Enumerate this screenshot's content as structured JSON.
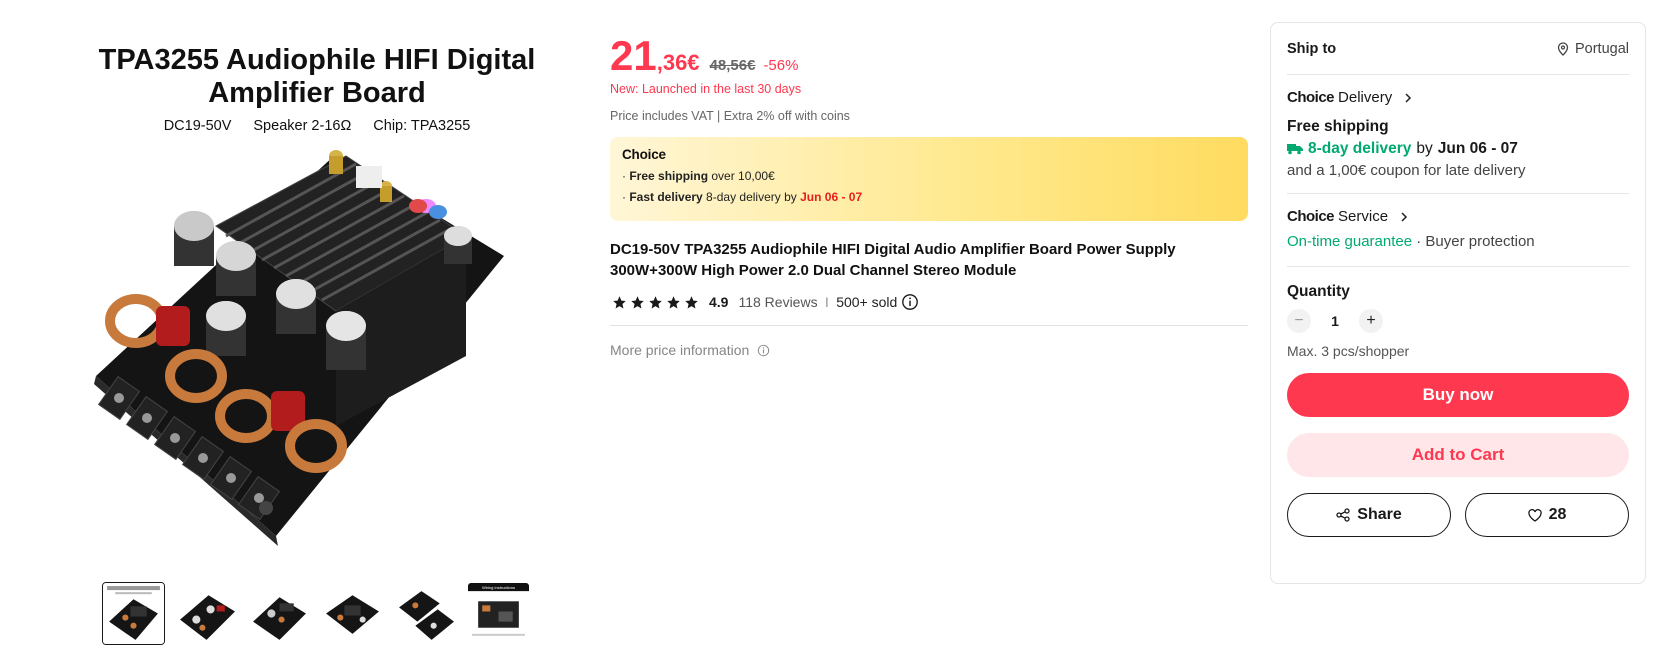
{
  "gallery": {
    "hero_title": "TPA3255 Audiophile HIFI Digital Amplifier Board",
    "hero_specs": [
      "DC19-50V",
      "Speaker 2-16Ω",
      "Chip: TPA3255"
    ],
    "thumbnail_count": 6,
    "active_thumbnail": 1,
    "thumb6_label": "Wiring instructions"
  },
  "price": {
    "integer": "21",
    "decimal": ",36€",
    "original": "48,56€",
    "discount": "-56%",
    "new_tag": "New: Launched in the last 30 days",
    "vat_note": "Price includes VAT | Extra 2% off with coins"
  },
  "choice_box": {
    "brand": "Choice",
    "free_shipping_label": "Free shipping",
    "free_shipping_text": " over 10,00€",
    "fast_delivery_label": "Fast delivery",
    "fast_delivery_text": " 8-day delivery by ",
    "fast_delivery_date": "Jun 06 - 07"
  },
  "product": {
    "title": "DC19-50V TPA3255 Audiophile HIFI Digital Audio Amplifier Board Power Supply 300W+300W High Power 2.0 Dual Channel Stereo Module",
    "rating": "4.9",
    "reviews": "118 Reviews",
    "sold": "500+ sold",
    "more_price": "More price information"
  },
  "panel": {
    "ship_to_label": "Ship to",
    "country": "Portugal",
    "delivery": {
      "brand": "Choice",
      "title": "Delivery",
      "free_shipping": "Free shipping",
      "speed": "8-day delivery",
      "by": "by",
      "date": "Jun 06 - 07",
      "coupon": "and a 1,00€ coupon for late delivery"
    },
    "service": {
      "brand": "Choice",
      "title": "Service",
      "guarantee": "On-time guarantee",
      "protection": " · Buyer protection"
    },
    "quantity": {
      "label": "Quantity",
      "value": "1",
      "max": "Max. 3 pcs/shopper"
    },
    "buy_now": "Buy now",
    "add_to_cart": "Add to Cart",
    "share": "Share",
    "wishlist_count": "28"
  },
  "colors": {
    "accent": "#fd384f",
    "green": "#01a971",
    "choice_yellow": "#ffdc60"
  }
}
